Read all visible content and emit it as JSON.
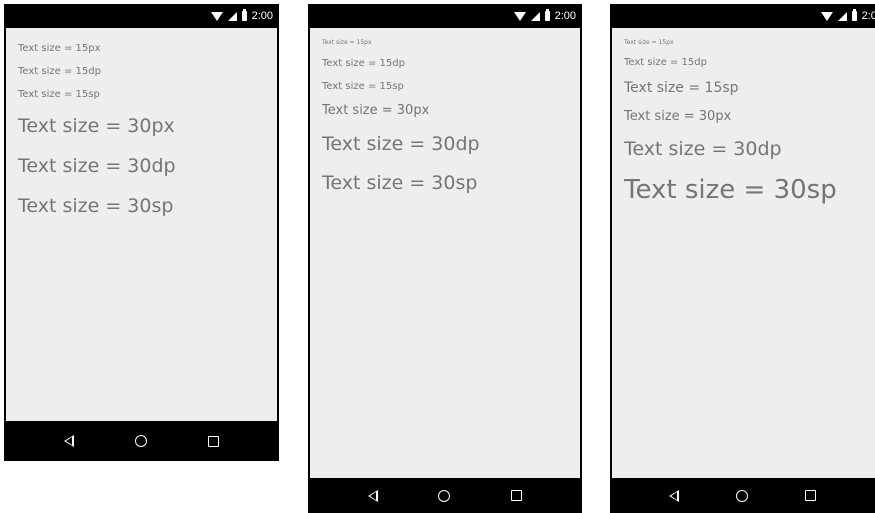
{
  "status_bar": {
    "time": "2:00",
    "icons": [
      "wifi-icon",
      "signal-icon",
      "battery-icon"
    ]
  },
  "nav_bar": {
    "icons": [
      "back-icon",
      "home-icon",
      "recents-icon"
    ]
  },
  "phones": [
    {
      "name": "phone-1",
      "lines": [
        "Text size = 15px",
        "Text size = 15dp",
        "Text size = 15sp",
        "Text size = 30px",
        "Text size = 30dp",
        "Text size = 30sp"
      ]
    },
    {
      "name": "phone-2",
      "lines": [
        "Text size = 15px",
        "Text size = 15dp",
        "Text size = 15sp",
        "Text size = 30px",
        "Text size = 30dp",
        "Text size = 30sp"
      ]
    },
    {
      "name": "phone-3",
      "lines": [
        "Text size = 15px",
        "Text size = 15dp",
        "Text size = 15sp",
        "Text size = 30px",
        "Text size = 30dp",
        "Text size = 30sp"
      ]
    }
  ],
  "colors": {
    "screen_bg": "#eeeeee",
    "text": "#757575",
    "frame": "#000000"
  }
}
